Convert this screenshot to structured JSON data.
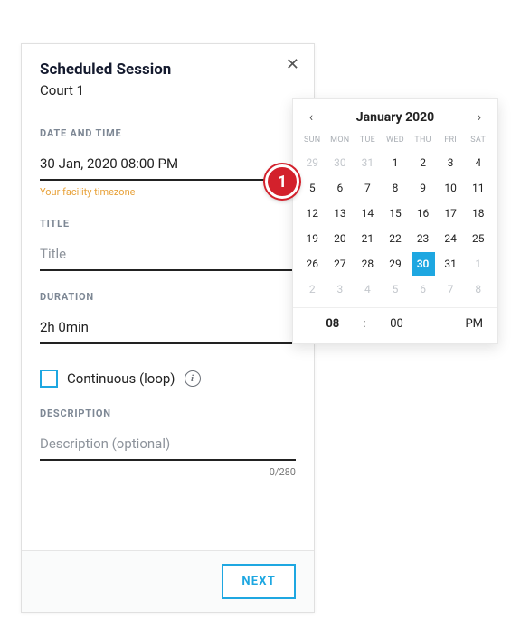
{
  "modal": {
    "title": "Scheduled Session",
    "subtitle": "Court 1",
    "close_glyph": "✕",
    "labels": {
      "date_time": "DATE AND TIME",
      "title": "TITLE",
      "duration": "DURATION",
      "description": "DESCRIPTION"
    },
    "fields": {
      "date_time_value": "30 Jan, 2020 08:00 PM",
      "date_time_helper": "Your facility timezone",
      "title_value": "",
      "title_placeholder": "Title",
      "duration_value": "2h 0min",
      "description_value": "",
      "description_placeholder": "Description (optional)",
      "description_counter": "0/280"
    },
    "continuous": {
      "checked": false,
      "label": "Continuous (loop)",
      "info_glyph": "i"
    },
    "buttons": {
      "next": "NEXT"
    }
  },
  "annotation": {
    "marker1": "1"
  },
  "picker": {
    "title": "January 2020",
    "prev_glyph": "‹",
    "next_glyph": "›",
    "dow": [
      "SUN",
      "MON",
      "TUE",
      "WED",
      "THU",
      "FRI",
      "SAT"
    ],
    "weeks": [
      [
        {
          "n": "29",
          "m": true
        },
        {
          "n": "30",
          "m": true
        },
        {
          "n": "31",
          "m": true
        },
        {
          "n": "1"
        },
        {
          "n": "2"
        },
        {
          "n": "3"
        },
        {
          "n": "4"
        }
      ],
      [
        {
          "n": "5"
        },
        {
          "n": "6"
        },
        {
          "n": "7"
        },
        {
          "n": "8"
        },
        {
          "n": "9"
        },
        {
          "n": "10"
        },
        {
          "n": "11"
        }
      ],
      [
        {
          "n": "12"
        },
        {
          "n": "13"
        },
        {
          "n": "14"
        },
        {
          "n": "15"
        },
        {
          "n": "16"
        },
        {
          "n": "17"
        },
        {
          "n": "18"
        }
      ],
      [
        {
          "n": "19"
        },
        {
          "n": "20"
        },
        {
          "n": "21"
        },
        {
          "n": "22"
        },
        {
          "n": "23"
        },
        {
          "n": "24"
        },
        {
          "n": "25"
        }
      ],
      [
        {
          "n": "26"
        },
        {
          "n": "27"
        },
        {
          "n": "28"
        },
        {
          "n": "29"
        },
        {
          "n": "30",
          "sel": true
        },
        {
          "n": "31"
        },
        {
          "n": "1",
          "m": true
        }
      ],
      [
        {
          "n": "2",
          "m": true
        },
        {
          "n": "3",
          "m": true
        },
        {
          "n": "4",
          "m": true
        },
        {
          "n": "5",
          "m": true
        },
        {
          "n": "6",
          "m": true
        },
        {
          "n": "7",
          "m": true
        },
        {
          "n": "8",
          "m": true
        }
      ]
    ],
    "time": {
      "hour": "08",
      "sep": ":",
      "min": "00",
      "ampm": "PM"
    }
  }
}
